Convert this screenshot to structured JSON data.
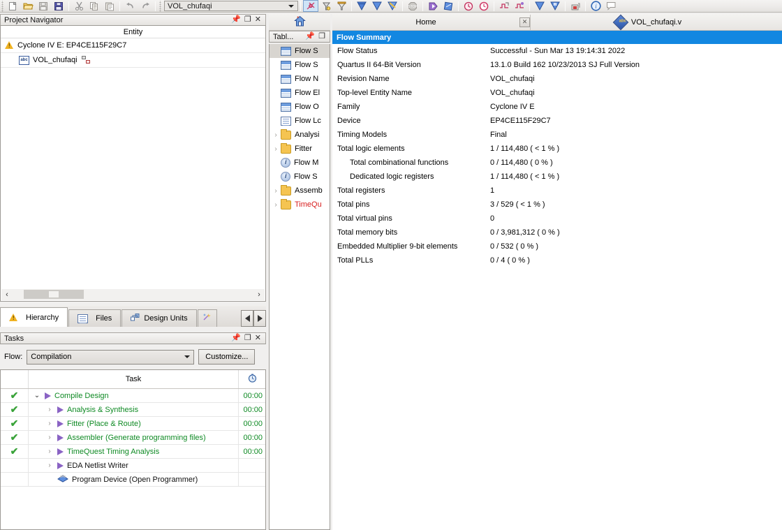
{
  "toolbar": {
    "project_combo_value": "VOL_chufaqi",
    "icons": [
      "new-file-icon",
      "open-folder-icon",
      "save-icon",
      "save-all-icon",
      "cut-icon",
      "copy-icon",
      "paste-icon",
      "undo-icon",
      "redo-icon"
    ],
    "right_icons": [
      "compilation-tool-icon",
      "pin-planner-icon",
      "settings-icon",
      "assignment-editor-icon",
      "start-compilation-icon",
      "start-analysis-icon",
      "start-fitter-icon",
      "stop-icon",
      "start-simulation-icon",
      "rtl-viewer-icon",
      "timing-analyzer-icon",
      "clock-icon",
      "signaltap-icon",
      "signal-probe-icon",
      "download-icon",
      "download-alt-icon",
      "programmer-icon",
      "help-icon",
      "comment-icon"
    ]
  },
  "project_navigator": {
    "title": "Project Navigator",
    "window_buttons": [
      "pin-icon",
      "restore-icon",
      "close-icon"
    ],
    "column_header": "Entity",
    "rows": [
      {
        "icon": "warning-triangle-icon",
        "label": "Cyclone IV E: EP4CE115F29C7",
        "indent": 0
      },
      {
        "icon": "verilog-file-icon",
        "label": "VOL_chufaqi",
        "indent": 1,
        "trailing_icon": "hierarchy-icon"
      }
    ],
    "tabs": [
      {
        "label": "Hierarchy",
        "icon": "warning-triangle-icon",
        "selected": true
      },
      {
        "label": "Files",
        "icon": "file-icon",
        "selected": false
      },
      {
        "label": "Design Units",
        "icon": "design-units-icon",
        "selected": false
      },
      {
        "label": "",
        "icon": "ip-components-icon",
        "selected": false
      }
    ],
    "nav_prev_icon": "chevron-left-icon",
    "nav_next_icon": "chevron-right-icon"
  },
  "tasks": {
    "title": "Tasks",
    "window_buttons": [
      "pin-icon",
      "restore-icon",
      "close-icon"
    ],
    "flow_label": "Flow:",
    "flow_value": "Compilation",
    "customize_label": "Customize...",
    "columns": {
      "task": "Task",
      "time": "clock-icon"
    },
    "rows": [
      {
        "status": "check",
        "expander": "down",
        "icon": "play-icon",
        "label": "Compile Design",
        "time": "00:00",
        "indent": 0,
        "green": true
      },
      {
        "status": "check",
        "expander": "right",
        "icon": "play-icon",
        "label": "Analysis & Synthesis",
        "time": "00:00",
        "indent": 1,
        "green": true
      },
      {
        "status": "check",
        "expander": "right",
        "icon": "play-icon",
        "label": "Fitter (Place & Route)",
        "time": "00:00",
        "indent": 1,
        "green": true
      },
      {
        "status": "check",
        "expander": "right",
        "icon": "play-icon",
        "label": "Assembler (Generate programming files)",
        "time": "00:00",
        "indent": 1,
        "green": true
      },
      {
        "status": "check",
        "expander": "right",
        "icon": "play-icon",
        "label": "TimeQuest Timing Analysis",
        "time": "00:00",
        "indent": 1,
        "green": true
      },
      {
        "status": "",
        "expander": "right",
        "icon": "play-icon",
        "label": "EDA Netlist Writer",
        "time": "",
        "indent": 1,
        "green": false
      },
      {
        "status": "",
        "expander": "none",
        "icon": "programmer-icon",
        "label": "Program Device (Open Programmer)",
        "time": "",
        "indent": 1,
        "green": false
      }
    ]
  },
  "table_of_contents": {
    "title": "Tabl...",
    "window_buttons": [
      "pin-icon",
      "restore-icon"
    ],
    "rows": [
      {
        "label": "Flow S",
        "icon": "report-table-icon",
        "expander": false,
        "selected": true,
        "red": false
      },
      {
        "label": "Flow S",
        "icon": "report-table-icon",
        "expander": false,
        "selected": false,
        "red": false
      },
      {
        "label": "Flow N",
        "icon": "report-table-icon",
        "expander": false,
        "selected": false,
        "red": false
      },
      {
        "label": "Flow El",
        "icon": "report-table-icon",
        "expander": false,
        "selected": false,
        "red": false
      },
      {
        "label": "Flow O",
        "icon": "report-table-icon",
        "expander": false,
        "selected": false,
        "red": false
      },
      {
        "label": "Flow Lc",
        "icon": "report-log-icon",
        "expander": false,
        "selected": false,
        "red": false
      },
      {
        "label": "Analysi",
        "icon": "folder-icon",
        "expander": true,
        "selected": false,
        "red": false
      },
      {
        "label": "Fitter",
        "icon": "folder-icon",
        "expander": true,
        "selected": false,
        "red": false
      },
      {
        "label": "Flow M",
        "icon": "info-icon",
        "expander": false,
        "selected": false,
        "red": false
      },
      {
        "label": "Flow S",
        "icon": "info-icon",
        "expander": false,
        "selected": false,
        "red": false
      },
      {
        "label": "Assemb",
        "icon": "folder-icon",
        "expander": true,
        "selected": false,
        "red": false
      },
      {
        "label": "TimeQu",
        "icon": "folder-icon",
        "expander": true,
        "selected": false,
        "red": true
      }
    ]
  },
  "document_area": {
    "tabs": [
      {
        "label": "Home",
        "icon": "home-icon",
        "closable": true,
        "selected": false
      },
      {
        "label": "VOL_chufaqi.v",
        "icon": "verilog-diamond-icon",
        "closable": false,
        "selected": true
      }
    ],
    "report_title": "Flow Summary",
    "summary_rows": [
      {
        "key": "Flow Status",
        "value": "Successful - Sun Mar 13 19:14:31 2022",
        "sub": false
      },
      {
        "key": "Quartus II 64-Bit Version",
        "value": "13.1.0 Build 162 10/23/2013 SJ Full Version",
        "sub": false
      },
      {
        "key": "Revision Name",
        "value": "VOL_chufaqi",
        "sub": false
      },
      {
        "key": "Top-level Entity Name",
        "value": "VOL_chufaqi",
        "sub": false
      },
      {
        "key": "Family",
        "value": "Cyclone IV E",
        "sub": false
      },
      {
        "key": "Device",
        "value": "EP4CE115F29C7",
        "sub": false
      },
      {
        "key": "Timing Models",
        "value": "Final",
        "sub": false
      },
      {
        "key": "Total logic elements",
        "value": "1 / 114,480 ( < 1 % )",
        "sub": false
      },
      {
        "key": "Total combinational functions",
        "value": "0 / 114,480 ( 0 % )",
        "sub": true
      },
      {
        "key": "Dedicated logic registers",
        "value": "1 / 114,480 ( < 1 % )",
        "sub": true
      },
      {
        "key": "Total registers",
        "value": "1",
        "sub": false
      },
      {
        "key": "Total pins",
        "value": "3 / 529 ( < 1 % )",
        "sub": false
      },
      {
        "key": "Total virtual pins",
        "value": "0",
        "sub": false
      },
      {
        "key": "Total memory bits",
        "value": "0 / 3,981,312 ( 0 % )",
        "sub": false
      },
      {
        "key": "Embedded Multiplier 9-bit elements",
        "value": "0 / 532 ( 0 % )",
        "sub": false
      },
      {
        "key": "Total PLLs",
        "value": "0 / 4 ( 0 % )",
        "sub": false
      }
    ]
  },
  "colors": {
    "report_header_bg": "#1287e1",
    "task_green": "#0f8a24",
    "toc_red": "#d81f1f",
    "panel_bg": "#f0efee"
  }
}
